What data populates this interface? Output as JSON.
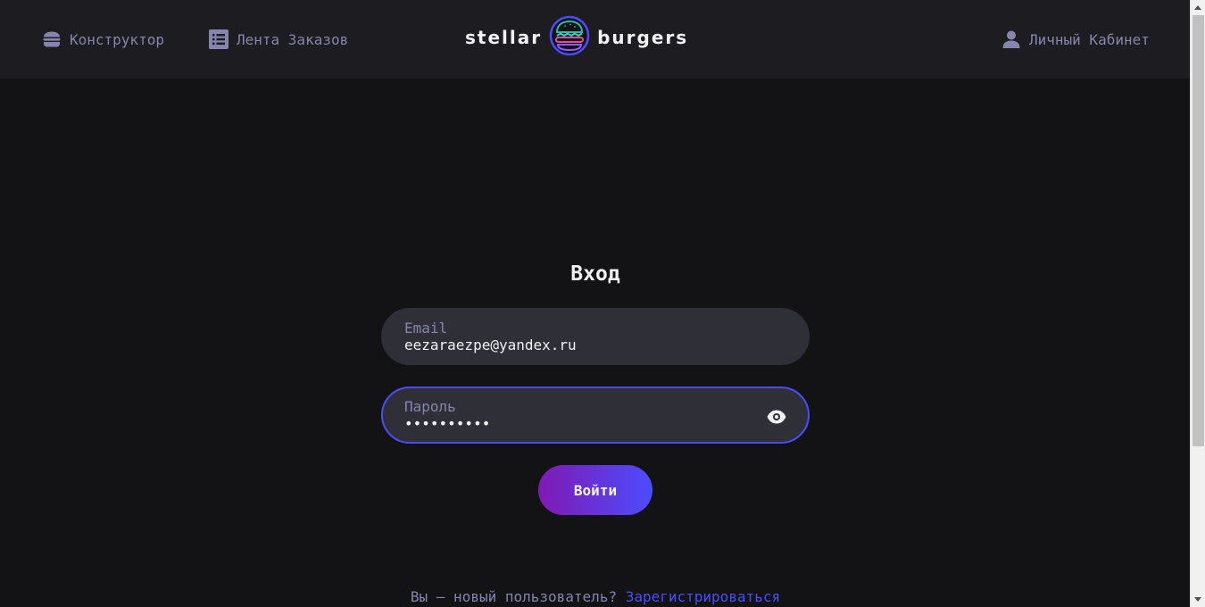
{
  "header": {
    "nav": {
      "constructor_label": "Конструктор",
      "feed_label": "Лента Заказов",
      "account_label": "Личный Кабинет"
    },
    "logo": {
      "left_text": "stellar",
      "right_text": "burgers"
    }
  },
  "login": {
    "title": "Вход",
    "email": {
      "label": "Email",
      "value": "eezaraezpe@yandex.ru"
    },
    "password": {
      "label": "Пароль",
      "value": "••••••••••"
    },
    "submit_label": "Войти",
    "register_prompt": "Вы — новый пользователь?",
    "register_link": "Зарегистрироваться"
  },
  "colors": {
    "background": "#131316",
    "header": "#1c1c21",
    "field": "#2f2f37",
    "accent": "#4c4cff",
    "accent_purple": "#801ab2",
    "inactive_text": "#8585ad",
    "primary_text": "#f2f2f3"
  },
  "icons": [
    "burger-icon",
    "list-icon",
    "profile-icon",
    "eye-icon"
  ]
}
